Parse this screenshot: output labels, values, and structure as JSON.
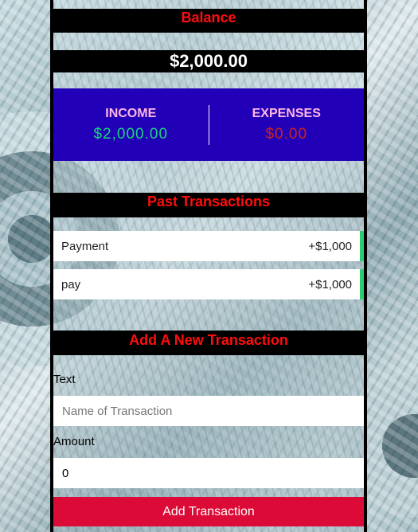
{
  "balance": {
    "heading": "Balance",
    "amount": "$2,000.00"
  },
  "summary": {
    "income_label": "INCOME",
    "income_value": "$2,000.00",
    "expenses_label": "EXPENSES",
    "expenses_value": "$0.00"
  },
  "history": {
    "heading": "Past Transactions",
    "items": [
      {
        "text": "Payment",
        "amount": "+$1,000"
      },
      {
        "text": "pay",
        "amount": "+$1,000"
      }
    ]
  },
  "form": {
    "heading": "Add A New Transaction",
    "text_label": "Text",
    "text_placeholder": "Name of Transaction",
    "text_value": "",
    "amount_label": "Amount",
    "amount_value": "0",
    "submit_label": "Add Transaction"
  },
  "colors": {
    "income": "#19d57a",
    "expense": "#c8241e",
    "heading": "#ff0d0d",
    "summary_bg": "#2200b8",
    "button": "#dc0a36",
    "plus_border": "#2ecc71"
  }
}
